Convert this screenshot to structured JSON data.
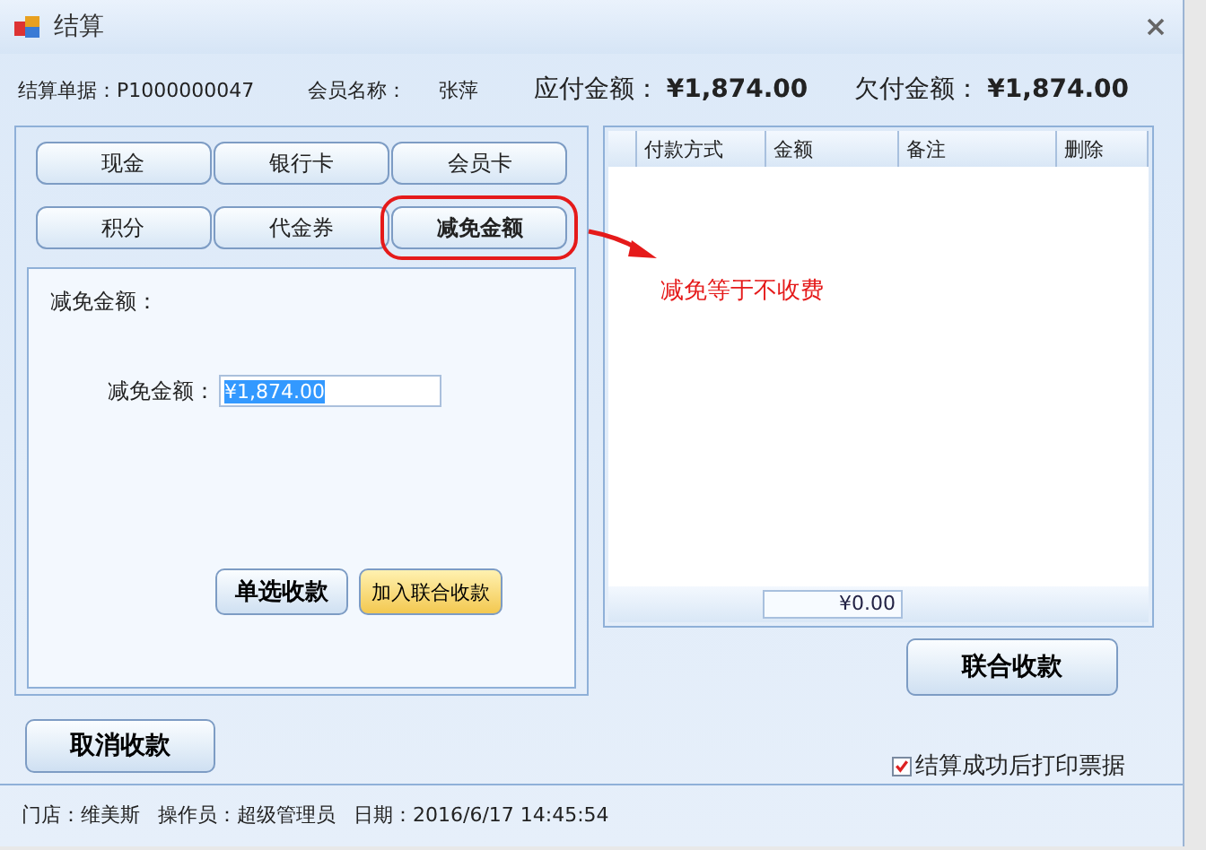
{
  "window": {
    "title": "结算"
  },
  "header": {
    "bill_label": "结算单据：",
    "bill_no": "P1000000047",
    "member_label": "会员名称：",
    "member_name": "张萍",
    "due_label": "应付金额：",
    "due_amount": "¥1,874.00",
    "owed_label": "欠付金额：",
    "owed_amount": "¥1,874.00"
  },
  "payment_methods": [
    {
      "label": "现金",
      "selected": false,
      "highlighted": false
    },
    {
      "label": "银行卡",
      "selected": false,
      "highlighted": false
    },
    {
      "label": "会员卡",
      "selected": false,
      "highlighted": false
    },
    {
      "label": "积分",
      "selected": false,
      "highlighted": false
    },
    {
      "label": "代金券",
      "selected": false,
      "highlighted": false
    },
    {
      "label": "减免金额",
      "selected": true,
      "highlighted": true
    }
  ],
  "annotation": {
    "text": "减免等于不收费"
  },
  "detail": {
    "title": "减免金额：",
    "field_label": "减免金额：",
    "field_value": "¥1,874.00",
    "buttons": [
      {
        "label": "单选收款",
        "kind": "normal"
      },
      {
        "label": "加入联合收款",
        "kind": "accent"
      }
    ]
  },
  "payments_table": {
    "columns": [
      "付款方式",
      "金额",
      "备注",
      "删除"
    ],
    "total": "¥0.00"
  },
  "combined_button": "联合收款",
  "cancel_button": "取消收款",
  "print_receipt": {
    "label": "结算成功后打印票据",
    "checked": true
  },
  "status_bar": {
    "store_label": "门店：",
    "store": "维美斯",
    "operator_label": "操作员：",
    "operator": "超级管理员",
    "date_label": "日期：",
    "date": "2016/6/17 14:45:54"
  }
}
